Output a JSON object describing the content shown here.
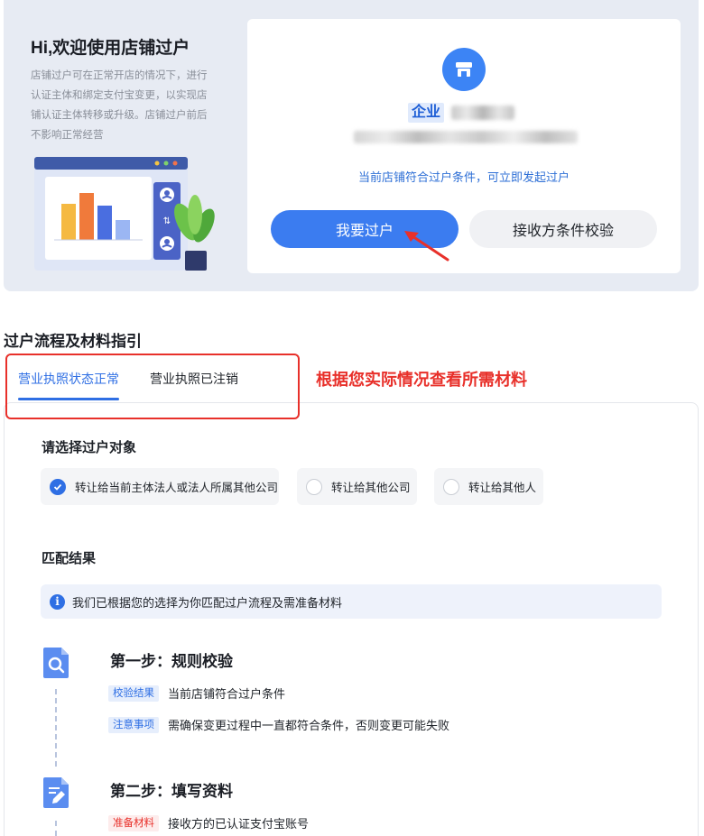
{
  "welcome": {
    "title": "Hi,欢迎使用店铺过户",
    "description": "店铺过户可在正常开店的情况下，进行认证主体和绑定支付宝变更，以实现店铺认证主体转移或升级。店铺过户前后不影响正常经营"
  },
  "shop": {
    "entity_tag": "企业",
    "status": "当前店铺符合过户条件，可立即发起过户",
    "primary_button": "我要过户",
    "secondary_button": "接收方条件校验"
  },
  "guide": {
    "title": "过户流程及材料指引",
    "tabs": [
      {
        "label": "营业执照状态正常",
        "active": true
      },
      {
        "label": "营业执照已注销",
        "active": false
      }
    ],
    "annotation": "根据您实际情况查看所需材料"
  },
  "select_target": {
    "title": "请选择过户对象",
    "options": [
      {
        "label": "转让给当前主体法人或法人所属其他公司",
        "checked": true
      },
      {
        "label": "转让给其他公司",
        "checked": false
      },
      {
        "label": "转让给其他人",
        "checked": false
      }
    ]
  },
  "match": {
    "title": "匹配结果",
    "tip": "我们已根据您的选择为你匹配过户流程及需准备材料"
  },
  "steps": [
    {
      "title": "第一步：规则校验",
      "notes": [
        {
          "tag": "校验结果",
          "text": "当前店铺符合过户条件"
        },
        {
          "tag": "注意事项",
          "text": "需确保变更过程中一直都符合条件，否则变更可能失败"
        }
      ]
    },
    {
      "title": "第二步：填写资料",
      "notes": [
        {
          "tag": "准备材料",
          "text": "接收方的已认证支付宝账号"
        }
      ]
    }
  ],
  "colors": {
    "primary": "#3b7cf0",
    "annotation_red": "#e8302a",
    "banner_bg": "#e7ebf3"
  }
}
